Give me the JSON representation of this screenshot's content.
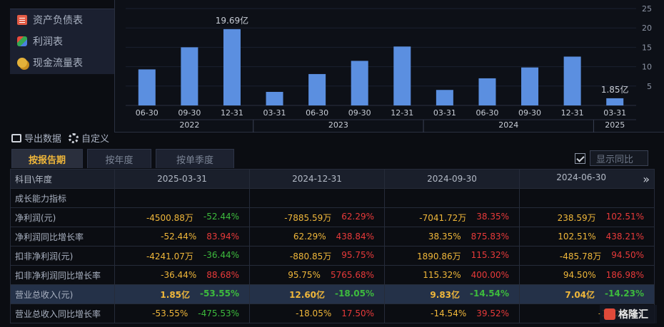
{
  "menu": {
    "items": [
      {
        "label": "资产负债表",
        "icon": "document-icon"
      },
      {
        "label": "利润表",
        "icon": "cube-icon"
      },
      {
        "label": "现金流量表",
        "icon": "coins-icon"
      }
    ]
  },
  "chart_data": {
    "type": "bar",
    "categories": [
      "06-30",
      "09-30",
      "12-31",
      "03-31",
      "06-30",
      "09-30",
      "12-31",
      "03-31",
      "06-30",
      "09-30",
      "12-31",
      "03-31"
    ],
    "years": [
      {
        "label": "2022",
        "count": 3
      },
      {
        "label": "2023",
        "count": 4
      },
      {
        "label": "2024",
        "count": 4
      },
      {
        "label": "2025",
        "count": 1
      }
    ],
    "values": [
      9.3,
      15.0,
      19.69,
      3.5,
      8.1,
      11.5,
      15.2,
      4.0,
      7.0,
      9.8,
      12.6,
      1.85
    ],
    "annotations": [
      {
        "index": 2,
        "text": "19.69亿"
      },
      {
        "index": 11,
        "text": "1.85亿"
      }
    ],
    "ylim": [
      0,
      25
    ],
    "yticks": [
      "5",
      "10",
      "15",
      "20",
      "25"
    ],
    "bar_color": "#5b8fe0"
  },
  "toolbar": {
    "export_label": "导出数据",
    "custom_label": "自定义"
  },
  "tabs": [
    "按报告期",
    "按年度",
    "按单季度"
  ],
  "yoy_label": "显示同比",
  "table": {
    "header_label": "科目\\年度",
    "columns": [
      "2025-03-31",
      "2024-12-31",
      "2024-09-30",
      "2024-06-30"
    ],
    "more": "»",
    "rows": [
      {
        "label": "成长能力指标",
        "section": true,
        "cells": []
      },
      {
        "label": "净利润(元)",
        "cells": [
          [
            "-4500.88万",
            "-52.44%",
            "neg"
          ],
          [
            "-7885.59万",
            "62.29%",
            "pos"
          ],
          [
            "-7041.72万",
            "38.35%",
            "pos"
          ],
          [
            "238.59万",
            "102.51%",
            "pos"
          ]
        ]
      },
      {
        "label": "净利润同比增长率",
        "cells": [
          [
            "-52.44%",
            "83.94%",
            "pos"
          ],
          [
            "62.29%",
            "438.84%",
            "pos"
          ],
          [
            "38.35%",
            "875.83%",
            "pos"
          ],
          [
            "102.51%",
            "438.21%",
            "pos"
          ]
        ]
      },
      {
        "label": "扣非净利润(元)",
        "cells": [
          [
            "-4241.07万",
            "-36.44%",
            "neg"
          ],
          [
            "-880.85万",
            "95.75%",
            "pos"
          ],
          [
            "1890.86万",
            "115.32%",
            "pos"
          ],
          [
            "-485.78万",
            "94.50%",
            "pos"
          ]
        ]
      },
      {
        "label": "扣非净利润同比增长率",
        "cells": [
          [
            "-36.44%",
            "88.68%",
            "pos"
          ],
          [
            "95.75%",
            "5765.68%",
            "pos"
          ],
          [
            "115.32%",
            "400.00%",
            "pos"
          ],
          [
            "94.50%",
            "186.98%",
            "pos"
          ]
        ]
      },
      {
        "label": "营业总收入(元)",
        "highlight": true,
        "cells": [
          [
            "1.85亿",
            "-53.55%",
            "neg"
          ],
          [
            "12.60亿",
            "-18.05%",
            "neg"
          ],
          [
            "9.83亿",
            "-14.54%",
            "neg"
          ],
          [
            "7.04亿",
            "-14.23%",
            "neg"
          ]
        ]
      },
      {
        "label": "营业总收入同比增长率",
        "cells": [
          [
            "-53.55%",
            "-475.53%",
            "neg"
          ],
          [
            "-18.05%",
            "17.50%",
            "pos"
          ],
          [
            "-14.54%",
            "39.52%",
            "pos"
          ],
          [
            "-14.23%",
            "",
            "pos"
          ]
        ]
      }
    ]
  },
  "logo_text": "格隆汇"
}
